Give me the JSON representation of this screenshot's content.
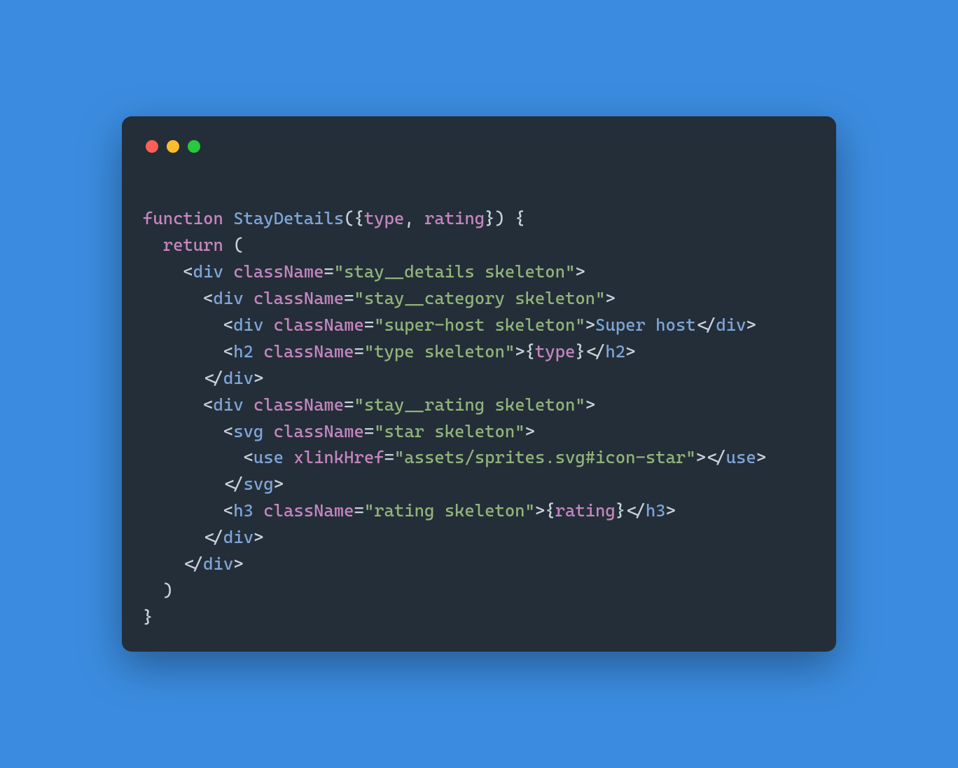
{
  "traffic": {
    "red": "#ff5f56",
    "yellow": "#ffbd2e",
    "green": "#27c93f"
  },
  "code": {
    "kw_function": "function",
    "fn_name": "StayDetails",
    "params": {
      "type": "type",
      "rating": "rating"
    },
    "kw_return": "return",
    "tags": {
      "div": "div",
      "h2": "h2",
      "svg": "svg",
      "use": "use",
      "h3": "h3"
    },
    "attrs": {
      "className": "className",
      "xlinkHref": "xlinkHref"
    },
    "strings": {
      "stay_details": "\"stay__details skeleton\"",
      "stay_category": "\"stay__category skeleton\"",
      "super_host": "\"super-host skeleton\"",
      "type_cls": "\"type skeleton\"",
      "stay_rating": "\"stay__rating skeleton\"",
      "star_cls": "\"star skeleton\"",
      "sprite_href": "\"assets/sprites.svg#icon-star\"",
      "rating_cls": "\"rating skeleton\""
    },
    "text": {
      "super_host_text": "Super host"
    },
    "expr": {
      "type": "type",
      "rating": "rating"
    }
  }
}
